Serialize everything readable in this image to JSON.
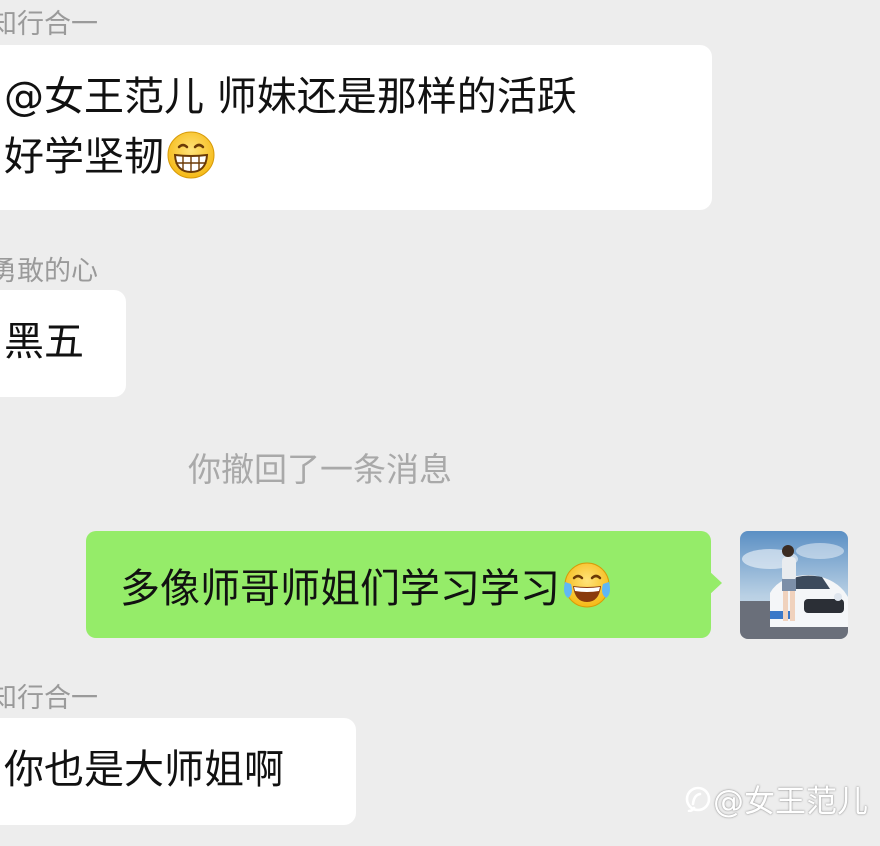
{
  "chat": {
    "messages": [
      {
        "sender": "知行合一",
        "lines": [
          "@女王范儿  师妹还是那样的活跃",
          "好学坚韧"
        ],
        "emoji": "grinning-face-emoji"
      },
      {
        "sender": "勇敢的心",
        "lines": [
          "黑五"
        ]
      },
      {
        "system": "你撤回了一条消息"
      },
      {
        "mine": true,
        "text": "多像师哥师姐们学习学习",
        "emoji": "tears-of-joy-emoji",
        "avatar": "user-avatar"
      },
      {
        "sender": "知行合一",
        "lines": [
          "你也是大师姐啊"
        ]
      }
    ]
  },
  "watermark": {
    "text": "@女王范儿",
    "icon": "zhihu-logo-icon"
  },
  "colors": {
    "background": "#ededed",
    "incoming_bubble": "#ffffff",
    "outgoing_bubble": "#95ec69",
    "sender_name": "#9a9a9a",
    "system_text": "#a9a9a9"
  }
}
